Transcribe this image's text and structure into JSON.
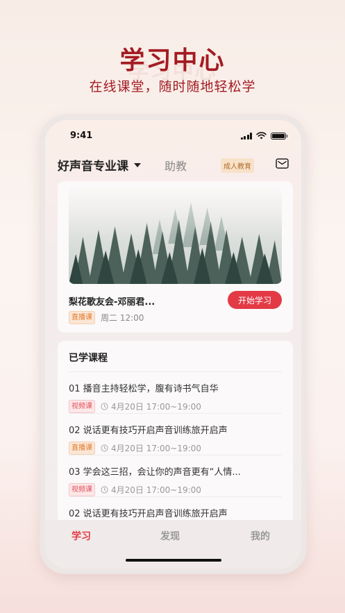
{
  "promo": {
    "title": "学习中心",
    "subtitle": "在线课堂，随时随地轻松学"
  },
  "status_bar": {
    "time": "9:41"
  },
  "header": {
    "course_name": "好声音专业课",
    "assistant_tab": "助教",
    "badge": "成人教育",
    "icons": [
      "chevron-down-icon",
      "mail-icon"
    ]
  },
  "live": {
    "title": "梨花歌友会-邓丽君...",
    "tag": "直播课",
    "time": "周二 12:00",
    "button": "开始学习"
  },
  "learned": {
    "title": "已学课程",
    "items": [
      {
        "title": "01 播音主持轻松学，腹有诗书气自华",
        "tag": "视频课",
        "tag_type": "video",
        "time": "4月20日 17:00~19:00"
      },
      {
        "title": "02 说话更有技巧开启声音训练旅开启声",
        "tag": "直播课",
        "tag_type": "live",
        "time": "4月20日 17:00~19:00"
      },
      {
        "title": "03 学会这三招，会让你的声音更有“人情...",
        "tag": "视频课",
        "tag_type": "video",
        "time": "4月20日 17:00~19:00"
      },
      {
        "title": "02 说话更有技巧开启声音训练旅开启声",
        "tag": "",
        "tag_type": "",
        "time": ""
      }
    ]
  },
  "tabs": [
    {
      "label": "学习",
      "active": true
    },
    {
      "label": "发现",
      "active": false
    },
    {
      "label": "我的",
      "active": false
    }
  ],
  "colors": {
    "brand": "#a31b22",
    "accent": "#e33a46"
  }
}
